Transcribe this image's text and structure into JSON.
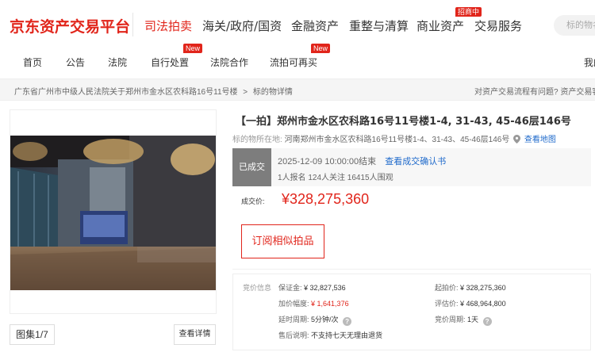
{
  "header": {
    "logo_text": "京东资产交易平台",
    "nav": [
      {
        "label": "司法拍卖",
        "active": true
      },
      {
        "label": "海关/政府/国资"
      },
      {
        "label": "金融资产"
      },
      {
        "label": "重整与清算"
      },
      {
        "label": "商业资产"
      },
      {
        "label": "交易服务"
      }
    ],
    "zhaoshang_badge": "招商中",
    "search_placeholder": "标的物名称"
  },
  "subnav": {
    "items": [
      "首页",
      "公告",
      "法院",
      "自行处置",
      "法院合作",
      "流拍可再买",
      "我的"
    ],
    "new_badge": "New"
  },
  "breadcrumb": {
    "items": [
      "广东省广州市中级人民法院关于郑州市金水区农科路16号11号楼",
      ">",
      "标的物详情"
    ],
    "help_text": "对资产交易流程有问题? 资产交易客服"
  },
  "gallery": {
    "counter": "图集1/7",
    "detail_button": "查看详情"
  },
  "lot": {
    "title": "【一拍】郑州市金水区农科路16号11号楼1-4, 31-43, 45-46层146号",
    "location_label": "标的物所在地:",
    "location_value": "河南郑州市金水区农科路16号11号楼1-4、31-43、45-46层146号",
    "map_link": "查看地图",
    "status": "已成交",
    "end_time": "2025-12-09 10:00:00结束",
    "confirm_link": "查看成交确认书",
    "counts": "1人报名  124人关注  16415人围观",
    "price_label": "成交价:",
    "price": "¥328,275,360",
    "subscribe_button": "订阅相似拍品"
  },
  "bid_info": {
    "section_label": "竞价信息",
    "deposit_label": "保证金:",
    "deposit_value": "¥ 32,827,536",
    "start_price_label": "起拍价:",
    "start_price_value": "¥ 328,275,360",
    "increment_label": "加价幅度:",
    "increment_value": "¥ 1,641,376",
    "appraisal_label": "评估价:",
    "appraisal_value": "¥ 468,964,800",
    "delay_label": "延时周期:",
    "delay_value": "5分钟/次",
    "bid_period_label": "竞价周期:",
    "bid_period_value": "1天",
    "after_sale_label": "售后说明:",
    "after_sale_value": "不支持七天无理由退货"
  },
  "colors": {
    "brand_red": "#e1251b",
    "link_blue": "#1f6acb",
    "status_gray": "#7d7d7d"
  }
}
